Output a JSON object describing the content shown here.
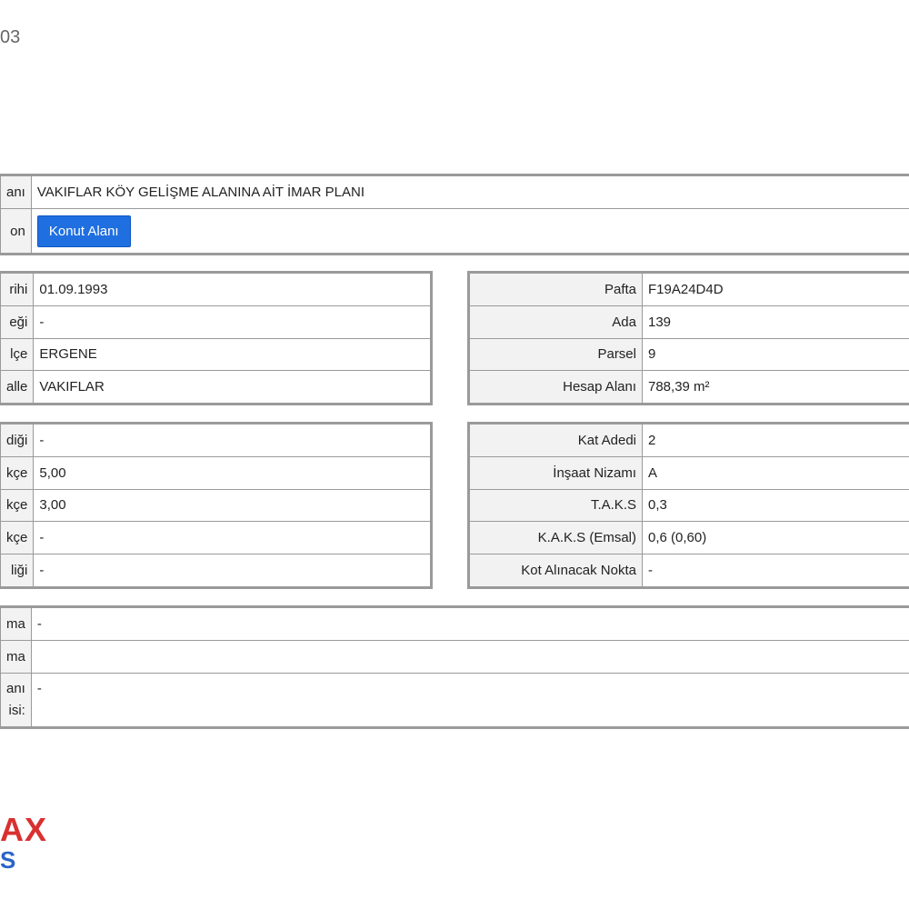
{
  "header_number": "03",
  "top": {
    "rows": [
      {
        "label": "anı",
        "value": "VAKIFLAR KÖY GELİŞME ALANINA AİT İMAR PLANI"
      },
      {
        "label": "on",
        "button": "Konut Alanı"
      }
    ]
  },
  "left1": [
    {
      "label": "rihi",
      "value": "01.09.1993"
    },
    {
      "label": "eği",
      "value": "-"
    },
    {
      "label": "lçe",
      "value": "ERGENE"
    },
    {
      "label": "alle",
      "value": "VAKIFLAR"
    }
  ],
  "right1": [
    {
      "label": "Pafta",
      "value": "F19A24D4D"
    },
    {
      "label": "Ada",
      "value": "139"
    },
    {
      "label": "Parsel",
      "value": "9"
    },
    {
      "label": "Hesap Alanı",
      "value": "788,39 m²"
    }
  ],
  "left2": [
    {
      "label": "diği",
      "value": "-"
    },
    {
      "label": "kçe",
      "value": "5,00"
    },
    {
      "label": "kçe",
      "value": "3,00"
    },
    {
      "label": "kçe",
      "value": "-"
    },
    {
      "label": "liği",
      "value": "-"
    }
  ],
  "right2": [
    {
      "label": "Kat Adedi",
      "value": "2"
    },
    {
      "label": "İnşaat Nizamı",
      "value": "A"
    },
    {
      "label": "T.A.K.S",
      "value": "0,3"
    },
    {
      "label": "K.A.K.S (Emsal)",
      "value": "0,6 (0,60)"
    },
    {
      "label": "Kot Alınacak Nokta",
      "value": "-"
    }
  ],
  "bottom": [
    {
      "label": "ma",
      "value": "-"
    },
    {
      "label": "ma",
      "value": ""
    },
    {
      "label1": "anı",
      "label2": "isi:",
      "value": "-"
    }
  ],
  "logo": {
    "line1": "AX",
    "line2": "S"
  }
}
